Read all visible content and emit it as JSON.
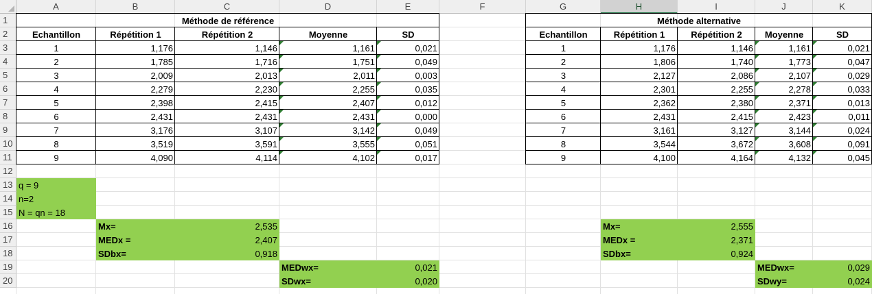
{
  "columns": [
    "A",
    "B",
    "C",
    "D",
    "E",
    "F",
    "G",
    "H",
    "I",
    "J",
    "K"
  ],
  "rows": [
    "1",
    "2",
    "3",
    "4",
    "5",
    "6",
    "7",
    "8",
    "9",
    "10",
    "11",
    "12",
    "13",
    "14",
    "15",
    "16",
    "17",
    "18",
    "19",
    "20"
  ],
  "selected_column": "H",
  "tables": {
    "reference": {
      "title": "Méthode de référence",
      "headers": [
        "Echantillon",
        "Répétition  1",
        "Répétition 2",
        "Moyenne",
        "SD"
      ],
      "rows": [
        [
          "1",
          "1,176",
          "1,146",
          "1,161",
          "0,021"
        ],
        [
          "2",
          "1,785",
          "1,716",
          "1,751",
          "0,049"
        ],
        [
          "3",
          "2,009",
          "2,013",
          "2,011",
          "0,003"
        ],
        [
          "4",
          "2,279",
          "2,230",
          "2,255",
          "0,035"
        ],
        [
          "5",
          "2,398",
          "2,415",
          "2,407",
          "0,012"
        ],
        [
          "6",
          "2,431",
          "2,431",
          "2,431",
          "0,000"
        ],
        [
          "7",
          "3,176",
          "3,107",
          "3,142",
          "0,049"
        ],
        [
          "8",
          "3,519",
          "3,591",
          "3,555",
          "0,051"
        ],
        [
          "9",
          "4,090",
          "4,114",
          "4,102",
          "0,017"
        ]
      ]
    },
    "alternative": {
      "title": "Méthode alternative",
      "headers": [
        "Echantillon",
        "Répétition 1",
        "Répétition 2",
        "Moyenne",
        "SD"
      ],
      "rows": [
        [
          "1",
          "1,176",
          "1,146",
          "1,161",
          "0,021"
        ],
        [
          "2",
          "1,806",
          "1,740",
          "1,773",
          "0,047"
        ],
        [
          "3",
          "2,127",
          "2,086",
          "2,107",
          "0,029"
        ],
        [
          "4",
          "2,301",
          "2,255",
          "2,278",
          "0,033"
        ],
        [
          "5",
          "2,362",
          "2,380",
          "2,371",
          "0,013"
        ],
        [
          "6",
          "2,431",
          "2,415",
          "2,423",
          "0,011"
        ],
        [
          "7",
          "3,161",
          "3,127",
          "3,144",
          "0,024"
        ],
        [
          "8",
          "3,544",
          "3,672",
          "3,608",
          "0,091"
        ],
        [
          "9",
          "4,100",
          "4,164",
          "4,132",
          "0,045"
        ]
      ]
    }
  },
  "params": [
    "q = 9",
    "n=2",
    "N = qn = 18"
  ],
  "stats_reference": [
    {
      "label": "Mx=",
      "value": "2,535"
    },
    {
      "label": "MEDx =",
      "value": "2,407"
    },
    {
      "label": "SDbx=",
      "value": "0,918"
    }
  ],
  "stats_alternative": [
    {
      "label": "Mx=",
      "value": "2,555"
    },
    {
      "label": "MEDx =",
      "value": "2,371"
    },
    {
      "label": "SDbx=",
      "value": "0,924"
    }
  ],
  "within_reference": [
    {
      "label": "MEDwx=",
      "value": "0,021"
    },
    {
      "label": "SDwx=",
      "value": "0,020"
    }
  ],
  "within_alternative": [
    {
      "label": "MEDwx=",
      "value": "0,029"
    },
    {
      "label": "SDwy=",
      "value": "0,024"
    }
  ],
  "colors": {
    "fill_green": "#92d050",
    "header_bg": "#efefef",
    "grid": "#e1e1e1",
    "excel_green": "#217346"
  }
}
